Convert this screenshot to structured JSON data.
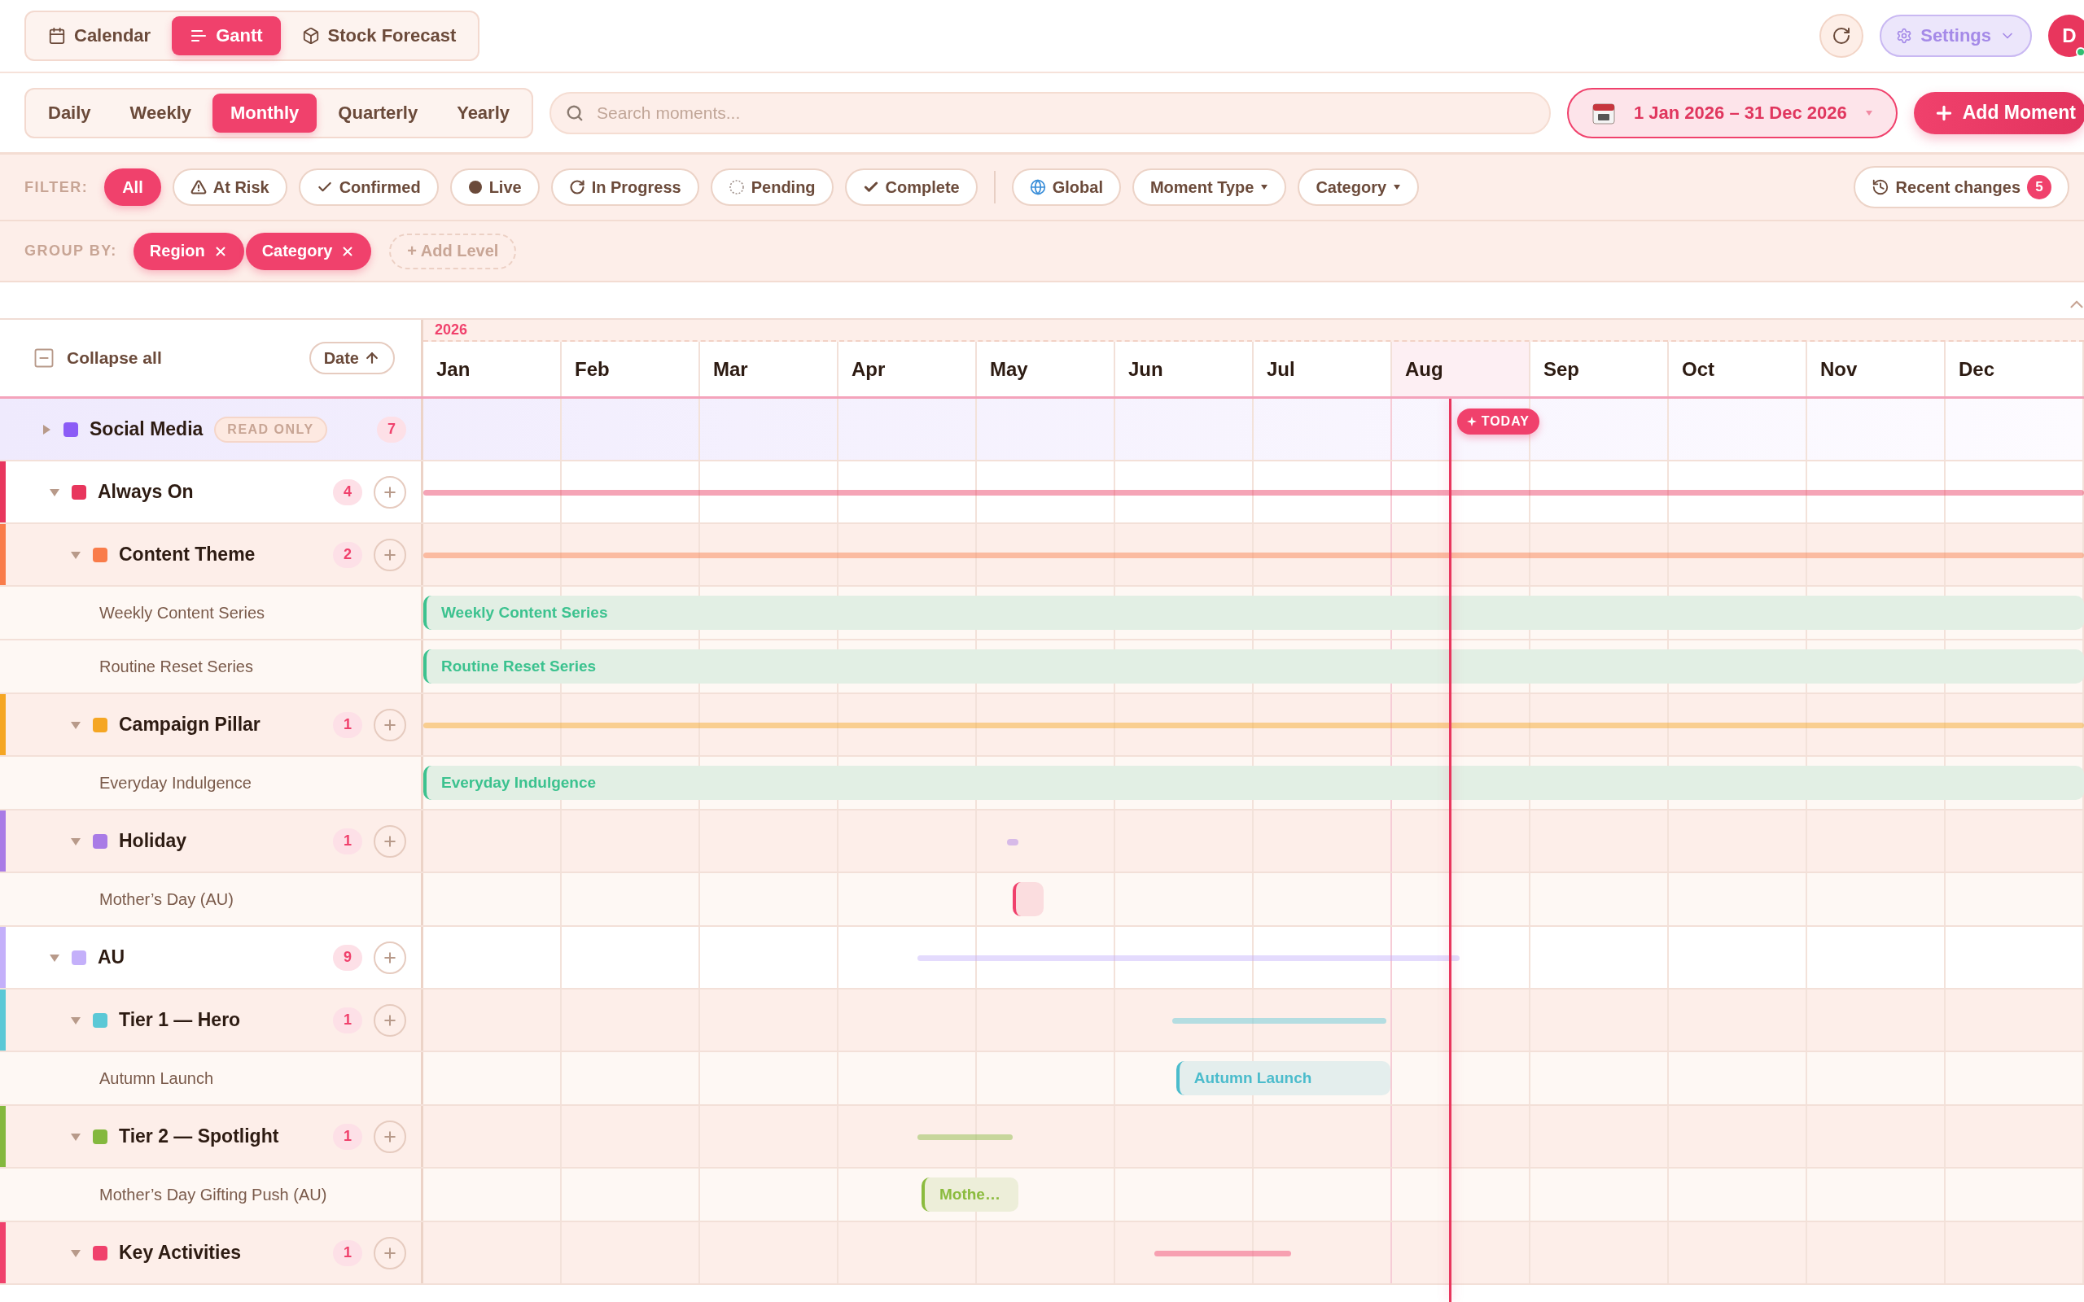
{
  "app_tabs": [
    {
      "label": "Calendar",
      "kind": "calendar",
      "selected": false
    },
    {
      "label": "Gantt",
      "kind": "gantt",
      "selected": true
    },
    {
      "label": "Stock Forecast",
      "kind": "stock",
      "selected": false
    }
  ],
  "settings_label": "Settings",
  "avatar": {
    "initial": "D",
    "online": true
  },
  "periods": [
    {
      "label": "Daily",
      "selected": false
    },
    {
      "label": "Weekly",
      "selected": false
    },
    {
      "label": "Monthly",
      "selected": true
    },
    {
      "label": "Quarterly",
      "selected": false
    },
    {
      "label": "Yearly",
      "selected": false
    }
  ],
  "search": {
    "placeholder": "Search moments..."
  },
  "date_range": "1 Jan 2026 – 31 Dec 2026",
  "add_button": "Add Moment",
  "filter": {
    "label": "FILTER:",
    "statuses": [
      {
        "label": "All",
        "kind": "all",
        "selected": true
      },
      {
        "label": "At Risk",
        "kind": "risk",
        "selected": false
      },
      {
        "label": "Confirmed",
        "kind": "confirmed",
        "selected": false
      },
      {
        "label": "Live",
        "kind": "live",
        "selected": false
      },
      {
        "label": "In Progress",
        "kind": "progress",
        "selected": false
      },
      {
        "label": "Pending",
        "kind": "pending",
        "selected": false
      },
      {
        "label": "Complete",
        "kind": "complete",
        "selected": false
      }
    ],
    "scopes": [
      {
        "label": "Global",
        "kind": "scope"
      },
      {
        "label": "Moment Type",
        "kind": "dropdown"
      },
      {
        "label": "Category",
        "kind": "dropdown"
      }
    ]
  },
  "recent_changes": {
    "label": "Recent changes",
    "count": "5"
  },
  "group_by": {
    "label": "GROUP BY:",
    "levels": [
      "Region",
      "Category"
    ],
    "add_label": "+ Add Level"
  },
  "gantt": {
    "collapse_label": "Collapse all",
    "sort_label": "Date",
    "year": "2026",
    "months": [
      {
        "label": "Jan",
        "current": false
      },
      {
        "label": "Feb",
        "current": false
      },
      {
        "label": "Mar",
        "current": false
      },
      {
        "label": "Apr",
        "current": false
      },
      {
        "label": "May",
        "current": false
      },
      {
        "label": "Jun",
        "current": false
      },
      {
        "label": "Jul",
        "current": false
      },
      {
        "label": "Aug",
        "current": true
      },
      {
        "label": "Sep",
        "current": false
      },
      {
        "label": "Oct",
        "current": false
      },
      {
        "label": "Nov",
        "current": false
      },
      {
        "label": "Dec",
        "current": false
      }
    ],
    "today_label": "TODAY",
    "groups": [
      {
        "name": "Social Media",
        "color": "#8b5cf6",
        "count": "7",
        "expanded": false,
        "read_only_label": "READ ONLY"
      },
      {
        "name": "Always On",
        "color": "#e8365d",
        "count": "4",
        "expanded": true,
        "children": [
          {
            "name": "Content Theme",
            "color": "#f97c4a",
            "count": "2",
            "expanded": true,
            "children": [
              {
                "name": "Weekly Content Series",
                "bar_label": "Weekly Content Series",
                "color": "#3cc28f"
              },
              {
                "name": "Routine Reset Series",
                "bar_label": "Routine Reset Series",
                "color": "#3cc28f"
              }
            ]
          },
          {
            "name": "Campaign Pillar",
            "color": "#f5a623",
            "count": "1",
            "expanded": true,
            "children": [
              {
                "name": "Everyday Indulgence",
                "bar_label": "Everyday Indulgence",
                "color": "#3cc28f"
              }
            ]
          },
          {
            "name": "Holiday",
            "color": "#a97be6",
            "count": "1",
            "expanded": true,
            "children": [
              {
                "name": "Mother’s Day (AU)",
                "color": "#f0416c"
              }
            ]
          }
        ]
      },
      {
        "name": "AU",
        "color": "#c4b0fa",
        "count": "9",
        "expanded": true,
        "children": [
          {
            "name": "Tier 1 — Hero",
            "color": "#5bc8d6",
            "count": "1",
            "expanded": true,
            "children": [
              {
                "name": "Autumn Launch",
                "bar_label": "Autumn Launch",
                "color": "#4bbccc"
              }
            ]
          },
          {
            "name": "Tier 2 — Spotlight",
            "color": "#84b83e",
            "count": "1",
            "expanded": true,
            "children": [
              {
                "name": "Mother’s Day Gifting Push (AU)",
                "bar_label": "Mothe…",
                "color": "#8bbb3e"
              }
            ]
          },
          {
            "name": "Key Activities",
            "color": "#f0416c",
            "count": "1",
            "expanded": true
          }
        ]
      }
    ]
  }
}
